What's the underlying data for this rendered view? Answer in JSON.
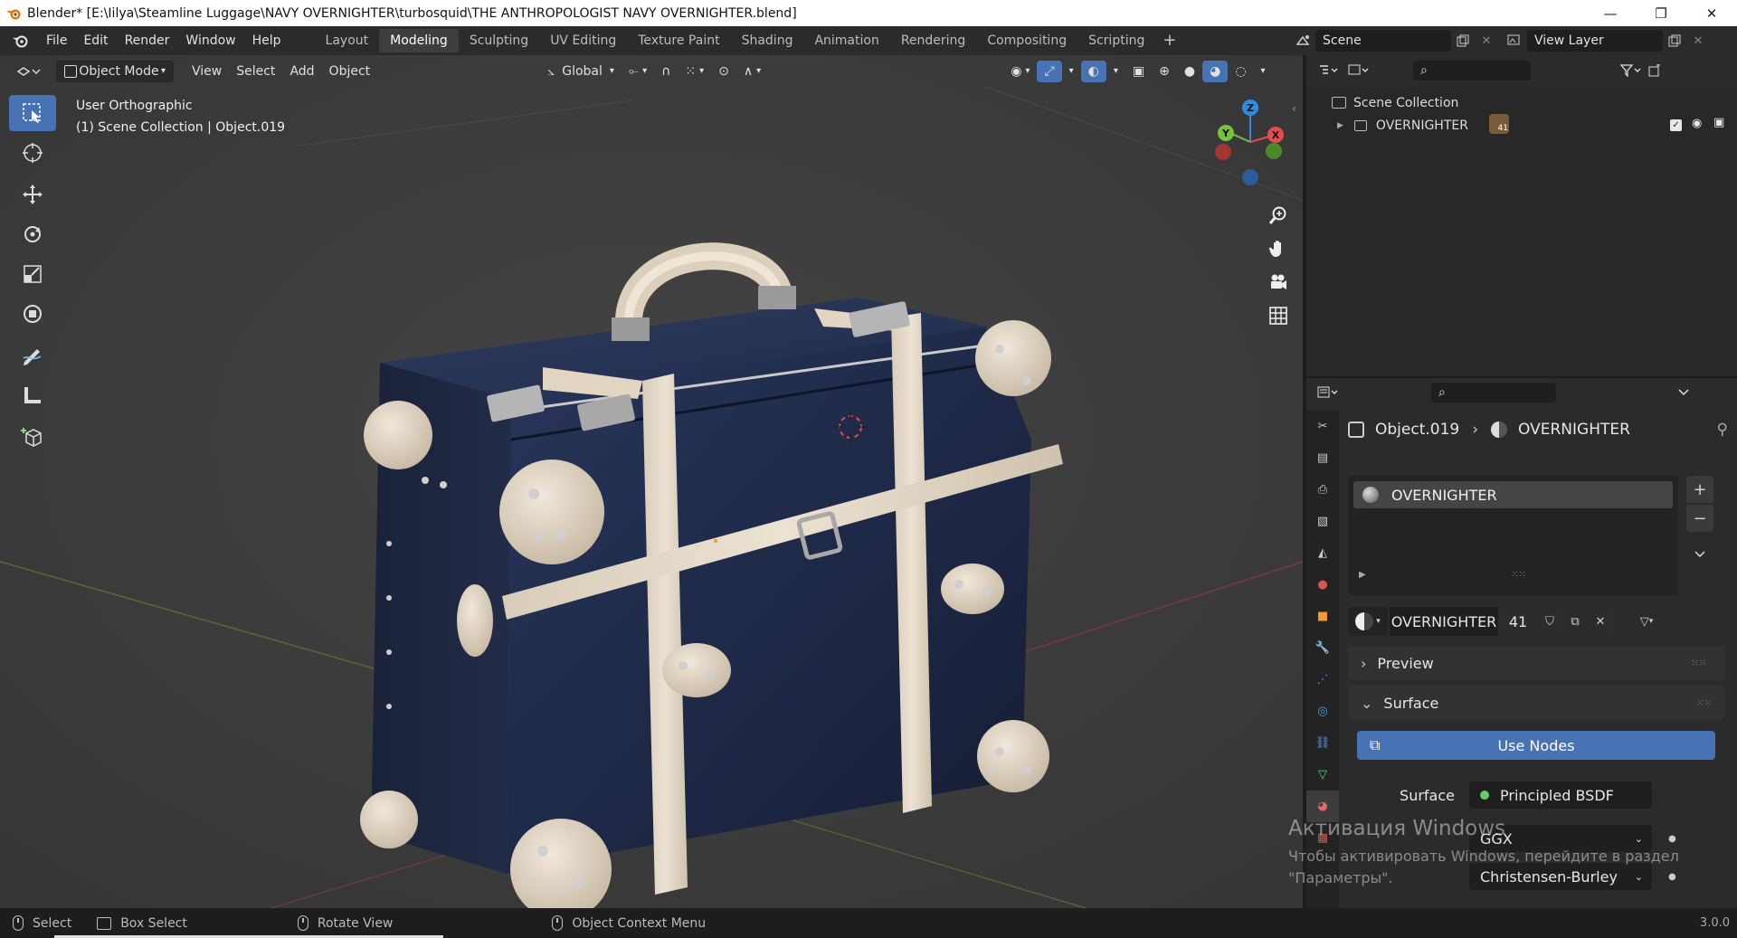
{
  "window": {
    "title": "Blender* [E:\\Iilya\\Steamline Luggage\\NAVY OVERNIGHTER\\turbosquid\\THE ANTHROPOLOGIST NAVY OVERNIGHTER.blend]",
    "controls": {
      "minimize": "—",
      "maximize": "❐",
      "close": "✕"
    }
  },
  "menu": [
    "File",
    "Edit",
    "Render",
    "Window",
    "Help"
  ],
  "workspaces": {
    "tabs": [
      "Layout",
      "Modeling",
      "Sculpting",
      "UV Editing",
      "Texture Paint",
      "Shading",
      "Animation",
      "Rendering",
      "Compositing",
      "Scripting"
    ],
    "active": "Modeling",
    "add": "+"
  },
  "scene": {
    "name": "Scene",
    "view_layer": "View Layer"
  },
  "viewport_header": {
    "mode": "Object Mode",
    "menus": [
      "View",
      "Select",
      "Add",
      "Object"
    ],
    "transform_orientation": "Global"
  },
  "viewport": {
    "view_name": "User Orthographic",
    "collection_info": "(1) Scene Collection | Object.019",
    "gizmo": {
      "z": "Z",
      "y": "Y",
      "x": "X"
    }
  },
  "outliner": {
    "root": "Scene Collection",
    "items": [
      {
        "name": "OVERNIGHTER",
        "badge_count": "41"
      }
    ]
  },
  "properties": {
    "breadcrumb": {
      "object": "Object.019",
      "material": "OVERNIGHTER"
    },
    "material_slot": "OVERNIGHTER",
    "material_name": "OVERNIGHTER",
    "user_count": "41",
    "panels": {
      "preview": "Preview",
      "surface": "Surface"
    },
    "use_nodes": "Use Nodes",
    "surface_label": "Surface",
    "surface_value": "Principled BSDF",
    "distribution": "GGX",
    "subsurface_method": "Christensen-Burley"
  },
  "statusbar": {
    "items": [
      "Select",
      "Box Select",
      "Rotate View",
      "Object Context Menu"
    ],
    "version": "3.0.0"
  },
  "watermark": {
    "line1": "Активация Windows",
    "line2": "Чтобы активировать Windows, перейдите в раздел",
    "line3": "\"Параметры\"."
  },
  "colors": {
    "accent": "#4772b3",
    "viewport_bg": "#3d3d3d",
    "case_navy": "#1f2a45",
    "leather_cream": "#e6d9c6"
  }
}
